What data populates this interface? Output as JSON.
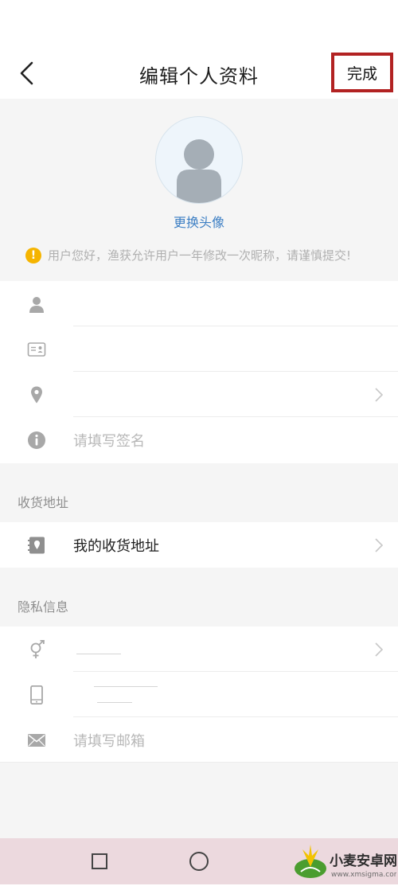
{
  "header": {
    "title": "编辑个人资料",
    "done_label": "完成"
  },
  "profile": {
    "change_avatar_label": "更换头像",
    "notice": "用户您好，渔获允许用户一年修改一次昵称，请谨慎提交!"
  },
  "basic_info": {
    "items": [
      {
        "icon": "person-icon",
        "value": ""
      },
      {
        "icon": "id-card-icon",
        "value": ""
      },
      {
        "icon": "location-pin-icon",
        "value": ""
      },
      {
        "icon": "info-icon",
        "value": "请填写签名"
      }
    ]
  },
  "shipping": {
    "section_title": "收货地址",
    "address_label": "我的收货地址",
    "icon": "address-book-icon"
  },
  "privacy": {
    "section_title": "隐私信息",
    "items": [
      {
        "icon": "gender-icon",
        "value": ""
      },
      {
        "icon": "phone-icon",
        "value": ""
      },
      {
        "icon": "mail-icon",
        "value": "请填写邮箱"
      }
    ]
  },
  "colors": {
    "accent_link": "#3d7fc4",
    "highlight_border": "#b22222",
    "warning": "#f5b400",
    "navbar_bg": "#ecd9de"
  },
  "watermark": {
    "brand": "小麦安卓网",
    "url": "www.xmsigma.com"
  }
}
